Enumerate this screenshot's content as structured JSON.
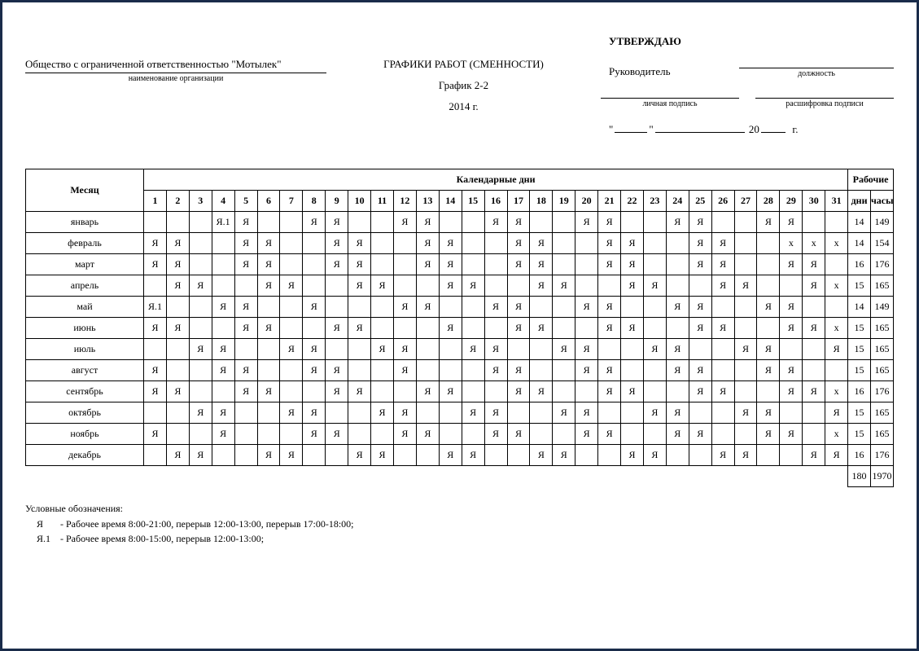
{
  "org": {
    "name": "Общество с ограниченной ответственностью \"Мотылек\"",
    "label": "наименование организации"
  },
  "center": {
    "title": "ГРАФИКИ РАБОТ (СМЕННОСТИ)",
    "subtitle": "График 2-2",
    "year": "2014 г."
  },
  "approve": {
    "utv": "УТВЕРЖДАЮ",
    "ruk": "Руководитель",
    "position_label": "должность",
    "sign_label": "личная подпись",
    "decipher_label": "расшифровка подписи",
    "date_20": "20",
    "date_g": "г."
  },
  "table": {
    "month_header": "Месяц",
    "days_header": "Календарные дни",
    "work_header": "Рабочие",
    "days_label": "дни",
    "hours_label": "часы",
    "day_numbers": [
      "1",
      "2",
      "3",
      "4",
      "5",
      "6",
      "7",
      "8",
      "9",
      "10",
      "11",
      "12",
      "13",
      "14",
      "15",
      "16",
      "17",
      "18",
      "19",
      "20",
      "21",
      "22",
      "23",
      "24",
      "25",
      "26",
      "27",
      "28",
      "29",
      "30",
      "31"
    ],
    "rows": [
      {
        "month": "январь",
        "d": [
          "",
          "",
          "",
          "Я.1",
          "Я",
          "",
          "",
          "Я",
          "Я",
          "",
          "",
          "Я",
          "Я",
          "",
          "",
          "Я",
          "Я",
          "",
          "",
          "Я",
          "Я",
          "",
          "",
          "Я",
          "Я",
          "",
          "",
          "Я",
          "Я",
          "",
          ""
        ],
        "days": "14",
        "hours": "149"
      },
      {
        "month": "февраль",
        "d": [
          "Я",
          "Я",
          "",
          "",
          "Я",
          "Я",
          "",
          "",
          "Я",
          "Я",
          "",
          "",
          "Я",
          "Я",
          "",
          "",
          "Я",
          "Я",
          "",
          "",
          "Я",
          "Я",
          "",
          "",
          "Я",
          "Я",
          "",
          "",
          "x",
          "x",
          "x"
        ],
        "days": "14",
        "hours": "154"
      },
      {
        "month": "март",
        "d": [
          "Я",
          "Я",
          "",
          "",
          "Я",
          "Я",
          "",
          "",
          "Я",
          "Я",
          "",
          "",
          "Я",
          "Я",
          "",
          "",
          "Я",
          "Я",
          "",
          "",
          "Я",
          "Я",
          "",
          "",
          "Я",
          "Я",
          "",
          "",
          "Я",
          "Я",
          ""
        ],
        "days": "16",
        "hours": "176"
      },
      {
        "month": "апрель",
        "d": [
          "",
          "Я",
          "Я",
          "",
          "",
          "Я",
          "Я",
          "",
          "",
          "Я",
          "Я",
          "",
          "",
          "Я",
          "Я",
          "",
          "",
          "Я",
          "Я",
          "",
          "",
          "Я",
          "Я",
          "",
          "",
          "Я",
          "Я",
          "",
          "",
          "Я",
          "x"
        ],
        "days": "15",
        "hours": "165"
      },
      {
        "month": "май",
        "d": [
          "Я.1",
          "",
          "",
          "Я",
          "Я",
          "",
          "",
          "Я",
          "",
          "",
          "",
          "Я",
          "Я",
          "",
          "",
          "Я",
          "Я",
          "",
          "",
          "Я",
          "Я",
          "",
          "",
          "Я",
          "Я",
          "",
          "",
          "Я",
          "Я",
          "",
          ""
        ],
        "days": "14",
        "hours": "149"
      },
      {
        "month": "июнь",
        "d": [
          "Я",
          "Я",
          "",
          "",
          "Я",
          "Я",
          "",
          "",
          "Я",
          "Я",
          "",
          "",
          "",
          "Я",
          "",
          "",
          "Я",
          "Я",
          "",
          "",
          "Я",
          "Я",
          "",
          "",
          "Я",
          "Я",
          "",
          "",
          "Я",
          "Я",
          "x"
        ],
        "days": "15",
        "hours": "165"
      },
      {
        "month": "июль",
        "d": [
          "",
          "",
          "Я",
          "Я",
          "",
          "",
          "Я",
          "Я",
          "",
          "",
          "Я",
          "Я",
          "",
          "",
          "Я",
          "Я",
          "",
          "",
          "Я",
          "Я",
          "",
          "",
          "Я",
          "Я",
          "",
          "",
          "Я",
          "Я",
          "",
          "",
          "Я"
        ],
        "days": "15",
        "hours": "165"
      },
      {
        "month": "август",
        "d": [
          "Я",
          "",
          "",
          "Я",
          "Я",
          "",
          "",
          "Я",
          "Я",
          "",
          "",
          "Я",
          "",
          "",
          "",
          "Я",
          "Я",
          "",
          "",
          "Я",
          "Я",
          "",
          "",
          "Я",
          "Я",
          "",
          "",
          "Я",
          "Я",
          "",
          ""
        ],
        "days": "15",
        "hours": "165"
      },
      {
        "month": "сентябрь",
        "d": [
          "Я",
          "Я",
          "",
          "",
          "Я",
          "Я",
          "",
          "",
          "Я",
          "Я",
          "",
          "",
          "Я",
          "Я",
          "",
          "",
          "Я",
          "Я",
          "",
          "",
          "Я",
          "Я",
          "",
          "",
          "Я",
          "Я",
          "",
          "",
          "Я",
          "Я",
          "x"
        ],
        "days": "16",
        "hours": "176"
      },
      {
        "month": "октябрь",
        "d": [
          "",
          "",
          "Я",
          "Я",
          "",
          "",
          "Я",
          "Я",
          "",
          "",
          "Я",
          "Я",
          "",
          "",
          "Я",
          "Я",
          "",
          "",
          "Я",
          "Я",
          "",
          "",
          "Я",
          "Я",
          "",
          "",
          "Я",
          "Я",
          "",
          "",
          "Я"
        ],
        "days": "15",
        "hours": "165"
      },
      {
        "month": "ноябрь",
        "d": [
          "Я",
          "",
          "",
          "Я",
          "",
          "",
          "",
          "Я",
          "Я",
          "",
          "",
          "Я",
          "Я",
          "",
          "",
          "Я",
          "Я",
          "",
          "",
          "Я",
          "Я",
          "",
          "",
          "Я",
          "Я",
          "",
          "",
          "Я",
          "Я",
          "",
          "x"
        ],
        "days": "15",
        "hours": "165"
      },
      {
        "month": "декабрь",
        "d": [
          "",
          "Я",
          "Я",
          "",
          "",
          "Я",
          "Я",
          "",
          "",
          "Я",
          "Я",
          "",
          "",
          "Я",
          "Я",
          "",
          "",
          "Я",
          "Я",
          "",
          "",
          "Я",
          "Я",
          "",
          "",
          "Я",
          "Я",
          "",
          "",
          "Я",
          "Я"
        ],
        "days": "16",
        "hours": "176"
      }
    ],
    "total_days": "180",
    "total_hours": "1970"
  },
  "legend": {
    "header": "Условные обозначения:",
    "items": [
      {
        "code": "Я",
        "sep": " - ",
        "text": "Рабочее время 8:00-21:00, перерыв 12:00-13:00, перерыв 17:00-18:00;"
      },
      {
        "code": "Я.1",
        "sep": " - ",
        "text": "Рабочее время 8:00-15:00, перерыв 12:00-13:00;"
      }
    ]
  }
}
